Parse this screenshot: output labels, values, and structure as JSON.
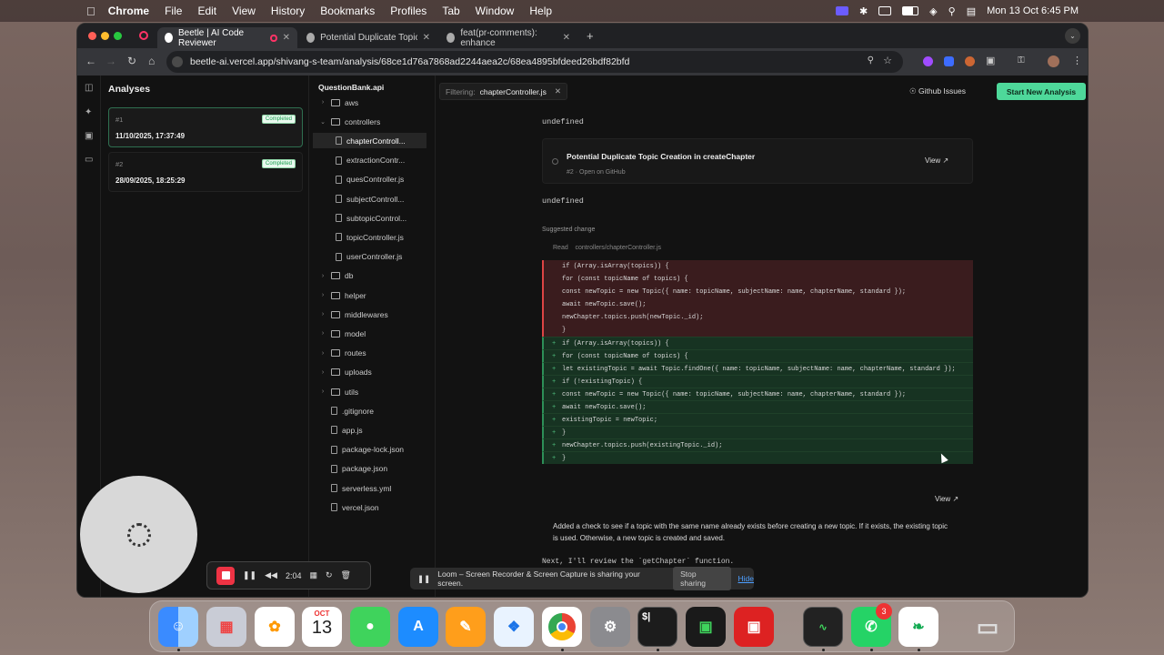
{
  "menubar": {
    "app_name": "Chrome",
    "items": [
      "File",
      "Edit",
      "View",
      "History",
      "Bookmarks",
      "Profiles",
      "Tab",
      "Window",
      "Help"
    ],
    "clock": "Mon 13 Oct  6:45 PM"
  },
  "browser": {
    "tabs": [
      {
        "title": "Beetle | AI Code Reviewer"
      },
      {
        "title": "Potential Duplicate Topic Cre"
      },
      {
        "title": "feat(pr-comments): enhance"
      }
    ],
    "url": "beetle-ai.vercel.app/shivang-s-team/analysis/68ce1d76a7868ad2244aea2c/68ea4895bfdeed26bdf82bfd"
  },
  "analyses": {
    "title": "Analyses",
    "items": [
      {
        "number": "#1",
        "datetime": "11/10/2025, 17:37:49",
        "status": "Completed"
      },
      {
        "number": "#2",
        "datetime": "28/09/2025, 18:25:29",
        "status": "Completed"
      }
    ]
  },
  "tree": {
    "root": "QuestionBank.api",
    "nodes": [
      {
        "name": "aws",
        "kind": "folder",
        "depth": 0,
        "expanded": false
      },
      {
        "name": "controllers",
        "kind": "folder",
        "depth": 0,
        "expanded": true
      },
      {
        "name": "chapterControll...",
        "kind": "file",
        "depth": 1,
        "selected": true
      },
      {
        "name": "extractionContr...",
        "kind": "file",
        "depth": 1
      },
      {
        "name": "quesController.js",
        "kind": "file",
        "depth": 1
      },
      {
        "name": "subjectControll...",
        "kind": "file",
        "depth": 1
      },
      {
        "name": "subtopicControl...",
        "kind": "file",
        "depth": 1
      },
      {
        "name": "topicController.js",
        "kind": "file",
        "depth": 1
      },
      {
        "name": "userController.js",
        "kind": "file",
        "depth": 1
      },
      {
        "name": "db",
        "kind": "folder",
        "depth": 0
      },
      {
        "name": "helper",
        "kind": "folder",
        "depth": 0
      },
      {
        "name": "middlewares",
        "kind": "folder",
        "depth": 0
      },
      {
        "name": "model",
        "kind": "folder",
        "depth": 0
      },
      {
        "name": "routes",
        "kind": "folder",
        "depth": 0
      },
      {
        "name": "uploads",
        "kind": "folder",
        "depth": 0
      },
      {
        "name": "utils",
        "kind": "folder",
        "depth": 0
      },
      {
        "name": ".gitignore",
        "kind": "file",
        "depth": 0
      },
      {
        "name": "app.js",
        "kind": "file",
        "depth": 0
      },
      {
        "name": "package-lock.json",
        "kind": "file",
        "depth": 0
      },
      {
        "name": "package.json",
        "kind": "file",
        "depth": 0
      },
      {
        "name": "serverless.yml",
        "kind": "file",
        "depth": 0
      },
      {
        "name": "vercel.json",
        "kind": "file",
        "depth": 0
      }
    ]
  },
  "toolbar": {
    "filter_label": "Filtering:",
    "filter_value": "chapterController.js",
    "github_issues": "Github Issues",
    "new_analysis": "Start New Analysis"
  },
  "content": {
    "undefined_1": "undefined",
    "issue": {
      "title": "Potential Duplicate Topic Creation in createChapter",
      "subtitle": "#2 · Open on GitHub",
      "view": "View"
    },
    "undefined_2": "undefined",
    "suggested_label": "Suggested change",
    "read_label": "Read",
    "read_path": "controllers/chapterController.js",
    "diff": [
      {
        "type": "del",
        "code": "if (Array.isArray(topics)) {"
      },
      {
        "type": "del",
        "code": "for (const topicName of topics) {"
      },
      {
        "type": "del",
        "code": "const newTopic = new Topic({ name: topicName, subjectName: name, chapterName, standard });"
      },
      {
        "type": "del",
        "code": "await newTopic.save();"
      },
      {
        "type": "del",
        "code": "newChapter.topics.push(newTopic._id);"
      },
      {
        "type": "del",
        "code": "}"
      },
      {
        "type": "add",
        "code": "if (Array.isArray(topics)) {"
      },
      {
        "type": "add",
        "code": "for (const topicName of topics) {"
      },
      {
        "type": "add",
        "code": "let existingTopic = await Topic.findOne({ name: topicName, subjectName: name, chapterName, standard });"
      },
      {
        "type": "add",
        "code": "if (!existingTopic) {"
      },
      {
        "type": "add",
        "code": "const newTopic = new Topic({ name: topicName, subjectName: name, chapterName, standard });"
      },
      {
        "type": "add",
        "code": "await newTopic.save();"
      },
      {
        "type": "add",
        "code": "existingTopic = newTopic;"
      },
      {
        "type": "add",
        "code": "}"
      },
      {
        "type": "add",
        "code": "newChapter.topics.push(existingTopic._id);"
      },
      {
        "type": "add",
        "code": "}"
      }
    ],
    "diff_view": "View",
    "description": "Added a check to see if a topic with the same name already exists before creating a new topic. If it exists, the existing topic is used. Otherwise, a new topic is created and saved.",
    "next_line": "Next, I'll review the `getChapter` function."
  },
  "loom": {
    "message": "Loom – Screen Recorder & Screen Capture is sharing your screen.",
    "stop": "Stop sharing",
    "hide": "Hide",
    "timer": "2:04"
  },
  "dock": {
    "calendar_month": "OCT",
    "calendar_day": "13",
    "whatsapp_badge": "3"
  },
  "colors": {
    "accent": "#4ed89a",
    "del_bg": "#3a1c1e",
    "add_bg": "#173322"
  }
}
